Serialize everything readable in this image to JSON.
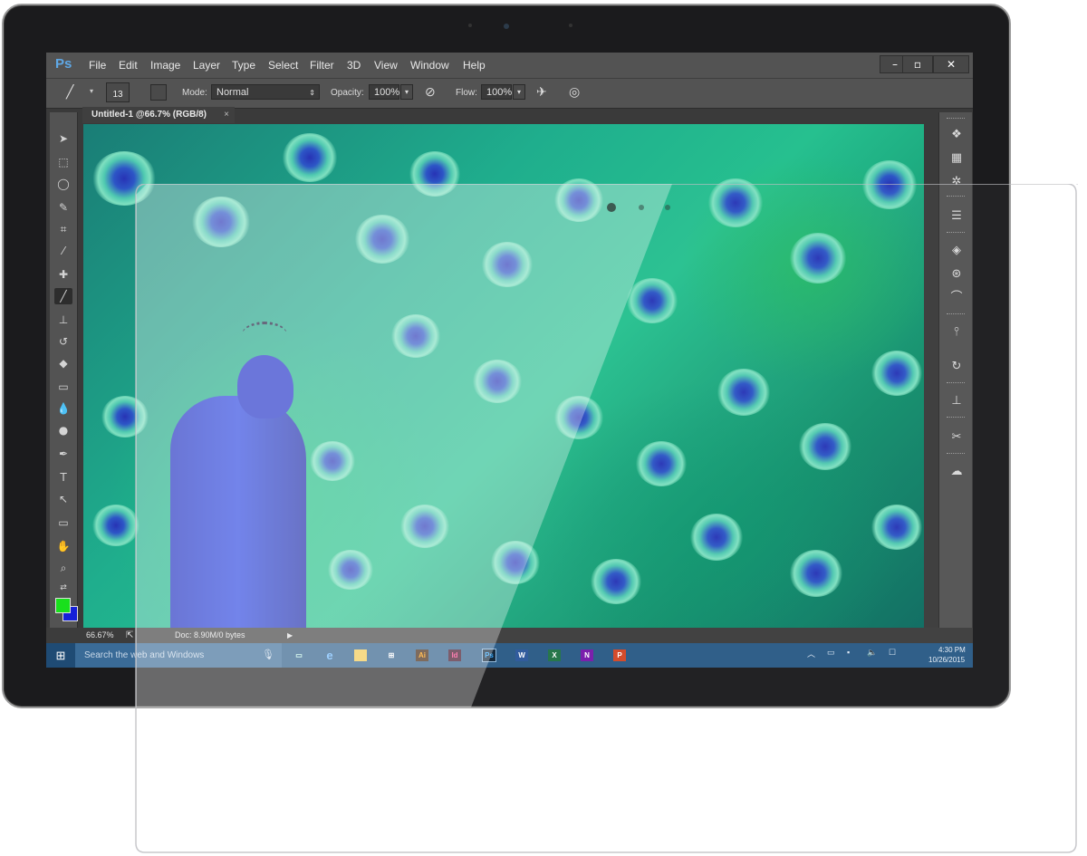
{
  "app": {
    "logo": "Ps"
  },
  "menu": [
    "File",
    "Edit",
    "Image",
    "Layer",
    "Type",
    "Select",
    "Filter",
    "3D",
    "View",
    "Window",
    "Help"
  ],
  "window_controls": [
    "–",
    "▫",
    "✕"
  ],
  "options": {
    "brush_size": "13",
    "mode_label": "Mode:",
    "mode_value": "Normal",
    "opacity_label": "Opacity:",
    "opacity_value": "100%",
    "flow_label": "Flow:",
    "flow_value": "100%"
  },
  "document": {
    "tab_title": "Untitled-1 @66.7% (RGB/8)",
    "tab_close": "×"
  },
  "status": {
    "zoom": "66.67%",
    "doc_info": "Doc: 8.90M/0 bytes"
  },
  "colors": {
    "foreground": "#19e01c",
    "background": "#1520d8",
    "taskbar": "#2a5a86"
  },
  "taskbar": {
    "search_placeholder": "Search the web and Windows",
    "apps": [
      "Ai",
      "Id",
      "Ps",
      "W",
      "X",
      "N",
      "P"
    ],
    "time": "4:30 PM",
    "date": "10/26/2015"
  }
}
